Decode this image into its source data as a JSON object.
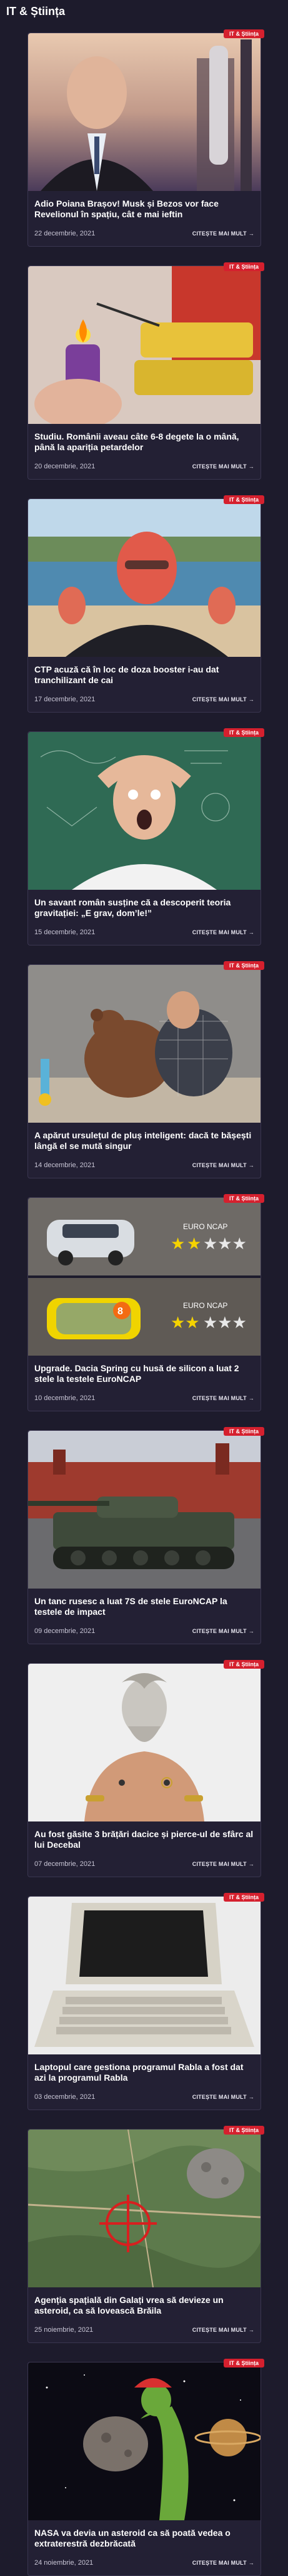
{
  "section": {
    "title": "IT & Știința"
  },
  "common": {
    "badge": "IT & Știința",
    "read_more": "CITEȘTE MAI MULT",
    "arrow": "→"
  },
  "articles": [
    {
      "title": "Adio Poiana Brașov! Musk și Bezos vor face Revelionul în spațiu, cât e mai ieftin",
      "date": "22 decembrie, 2021",
      "image": "bezos-rocket-photo"
    },
    {
      "title": "Studiu. Românii aveau câte 6-8 degete la o mână, până la apariția petardelor",
      "date": "20 decembrie, 2021",
      "image": "firecracker-lighter-photo"
    },
    {
      "title": "CTP acuză că în loc de doza booster i-au dat tranchilizant de cai",
      "date": "17 decembrie, 2021",
      "image": "ctp-beach-photo"
    },
    {
      "title": "Un savant român susține că a descoperit teoria gravitației: „E grav, dom’le!”",
      "date": "15 decembrie, 2021",
      "image": "shocked-man-chalkboard-photo"
    },
    {
      "title": "A apărut ursulețul de pluș inteligent: dacă te bășești lângă el se mută singur",
      "date": "14 decembrie, 2021",
      "image": "man-hugging-teddy-photo"
    },
    {
      "title": "Upgrade. Dacia Spring cu husă de silicon a luat 2 stele la testele EuroNCAP",
      "date": "10 decembrie, 2021",
      "image": "dacia-spring-euroncap-photo"
    },
    {
      "title": "Un tanc rusesc a luat 7S de stele EuroNCAP la testele de impact",
      "date": "09 decembrie, 2021",
      "image": "russian-tank-photo"
    },
    {
      "title": "Au fost găsite 3 brățări dacice și pierce-ul de sfârc al lui Decebal",
      "date": "07 decembrie, 2021",
      "image": "decebal-statue-photo"
    },
    {
      "title": "Laptopul care gestiona programul Rabla a fost dat azi la programul Rabla",
      "date": "03 decembrie, 2021",
      "image": "old-laptop-photo"
    },
    {
      "title": "Agenția spațială din Galați vrea să devieze un asteroid, ca să lovească Brăila",
      "date": "25 noiembrie, 2021",
      "image": "asteroid-map-photo"
    },
    {
      "title": "NASA va devia un asteroid ca să poată vedea o extraterestră dezbrăcată",
      "date": "24 noiembrie, 2021",
      "image": "asteroid-alien-photo"
    }
  ],
  "colors": {
    "background": "#1d1b2c",
    "card": "#232034",
    "badge": "#d5202e"
  }
}
